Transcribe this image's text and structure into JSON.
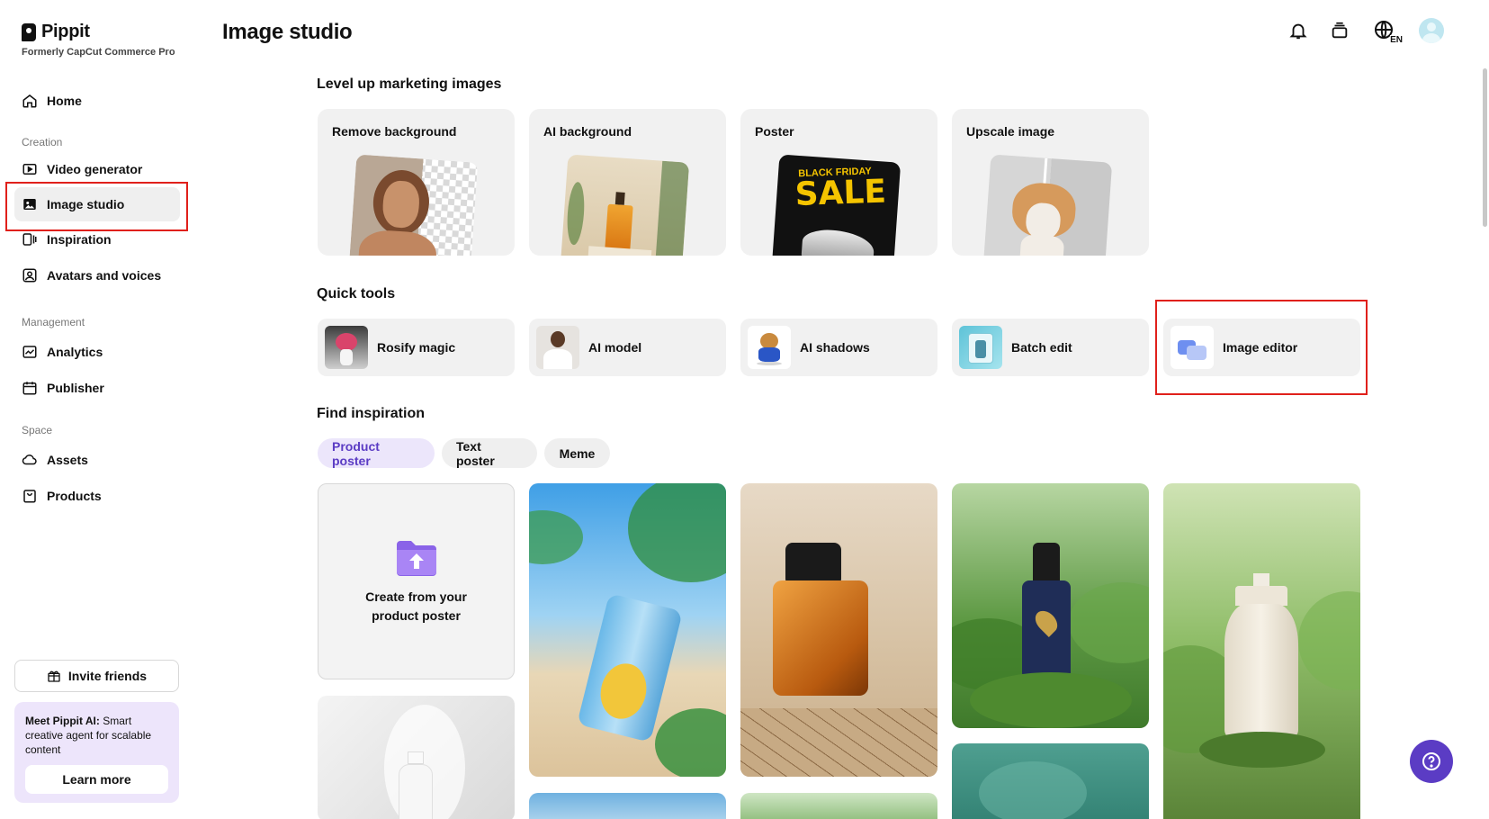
{
  "brand": {
    "name": "Pippit",
    "subtitle": "Formerly CapCut Commerce Pro"
  },
  "sidebar": {
    "top_items": [
      {
        "label": "Home",
        "icon": "home-icon"
      }
    ],
    "sections": [
      {
        "title": "Creation",
        "items": [
          {
            "label": "Video generator",
            "icon": "video-generator-icon"
          },
          {
            "label": "Image studio",
            "icon": "image-studio-icon",
            "active": true
          },
          {
            "label": "Inspiration",
            "icon": "inspiration-icon"
          },
          {
            "label": "Avatars and voices",
            "icon": "avatar-icon"
          }
        ]
      },
      {
        "title": "Management",
        "items": [
          {
            "label": "Analytics",
            "icon": "analytics-icon"
          },
          {
            "label": "Publisher",
            "icon": "calendar-icon"
          }
        ]
      },
      {
        "title": "Space",
        "items": [
          {
            "label": "Assets",
            "icon": "cloud-icon"
          },
          {
            "label": "Products",
            "icon": "bag-icon"
          }
        ]
      }
    ],
    "invite_label": "Invite friends",
    "promo": {
      "bold": "Meet Pippit AI:",
      "text": " Smart creative agent for scalable content",
      "button": "Learn more"
    }
  },
  "header": {
    "title": "Image studio",
    "lang": "EN"
  },
  "marketing": {
    "title": "Level up marketing images",
    "cards": [
      {
        "label": "Remove background"
      },
      {
        "label": "AI background"
      },
      {
        "label": "Poster",
        "art_text_top": "BLACK FRIDAY",
        "art_text_main": "SALE"
      },
      {
        "label": "Upscale image"
      }
    ]
  },
  "quick_tools": {
    "title": "Quick tools",
    "items": [
      {
        "label": "Rosify magic"
      },
      {
        "label": "AI model"
      },
      {
        "label": "AI shadows"
      },
      {
        "label": "Batch edit"
      },
      {
        "label": "Image editor"
      }
    ]
  },
  "inspiration": {
    "title": "Find inspiration",
    "tabs": [
      {
        "label": "Product poster",
        "active": true
      },
      {
        "label": "Text poster"
      },
      {
        "label": "Meme"
      }
    ],
    "create_label": "Create from your product poster"
  },
  "colors": {
    "accent": "#5b3cc4",
    "highlight": "#e0201b",
    "card_bg": "#f1f1f1"
  }
}
